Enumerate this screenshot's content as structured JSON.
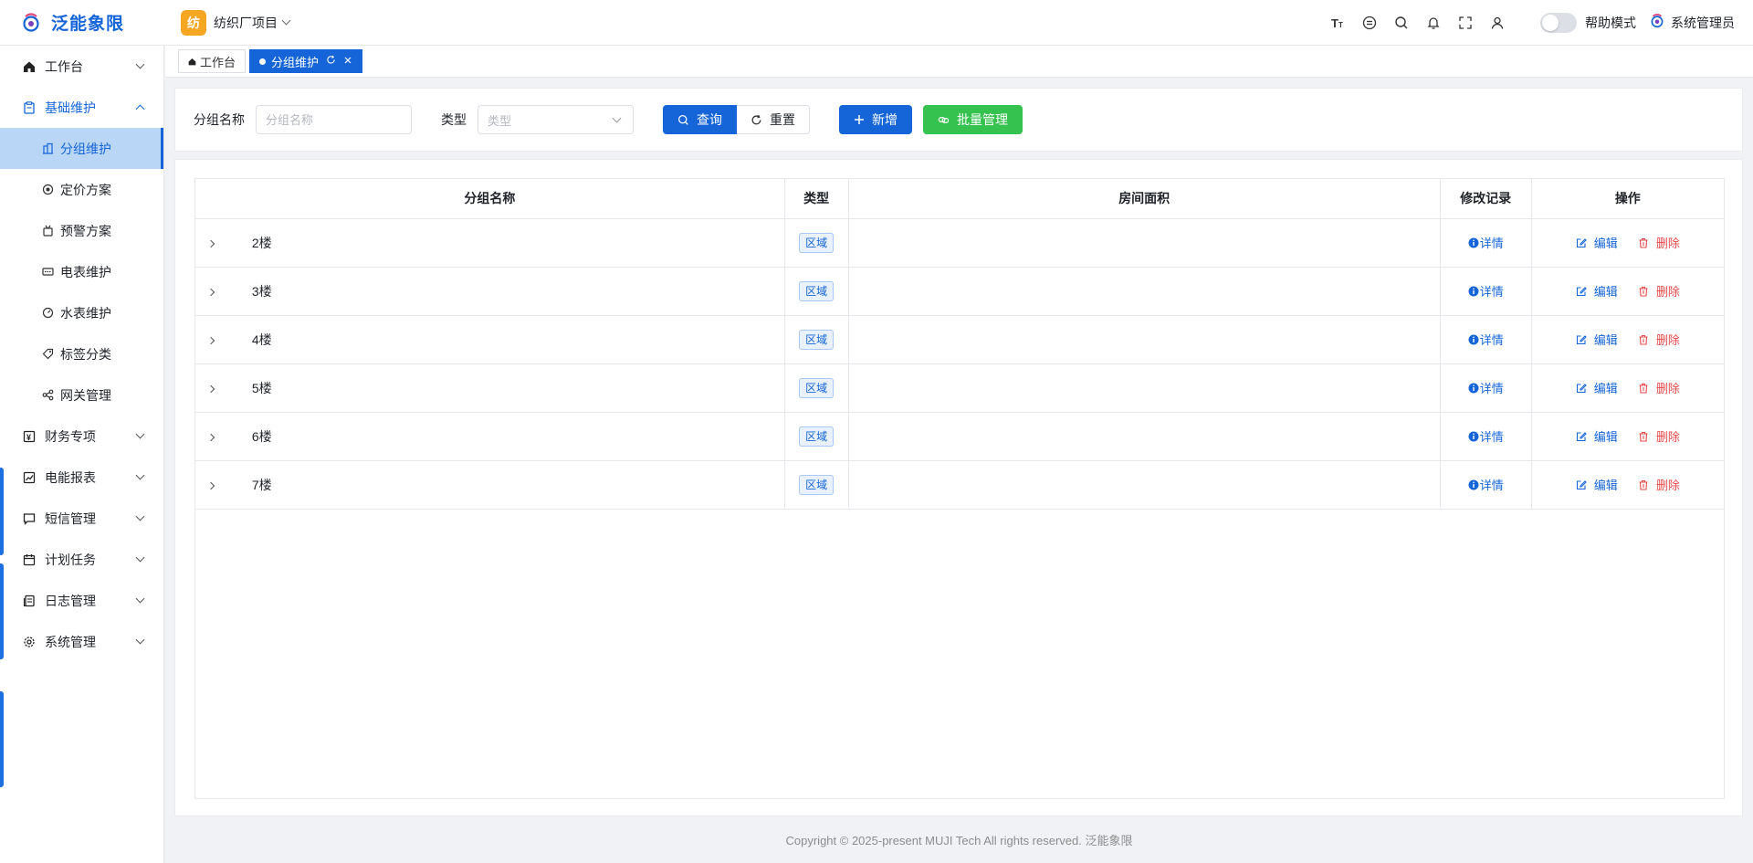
{
  "header": {
    "app_name": "泛能象限",
    "project_badge": "纺",
    "project_name": "纺织厂项目",
    "help_mode_label": "帮助模式",
    "user_name": "系统管理员",
    "icons": [
      "text-size-icon",
      "theme-icon",
      "search-icon",
      "bell-icon",
      "fullscreen-icon",
      "user-icon"
    ]
  },
  "sidebar": {
    "items": [
      {
        "label": "工作台",
        "icon": "home-icon",
        "expanded": false
      },
      {
        "label": "基础维护",
        "icon": "clipboard-icon",
        "expanded": true,
        "children": [
          {
            "label": "分组维护",
            "icon": "building-icon",
            "active": true
          },
          {
            "label": "定价方案",
            "icon": "price-icon"
          },
          {
            "label": "预警方案",
            "icon": "alarm-icon"
          },
          {
            "label": "电表维护",
            "icon": "meter-icon"
          },
          {
            "label": "水表维护",
            "icon": "gauge-icon"
          },
          {
            "label": "标签分类",
            "icon": "tag-icon"
          },
          {
            "label": "网关管理",
            "icon": "share-icon"
          }
        ]
      },
      {
        "label": "财务专项",
        "icon": "finance-icon",
        "expanded": false
      },
      {
        "label": "电能报表",
        "icon": "chart-icon",
        "expanded": false
      },
      {
        "label": "短信管理",
        "icon": "message-icon",
        "expanded": false
      },
      {
        "label": "计划任务",
        "icon": "calendar-icon",
        "expanded": false
      },
      {
        "label": "日志管理",
        "icon": "log-icon",
        "expanded": false
      },
      {
        "label": "系统管理",
        "icon": "settings-icon",
        "expanded": false
      }
    ]
  },
  "tabs": [
    {
      "label": "工作台",
      "active": false
    },
    {
      "label": "分组维护",
      "active": true
    }
  ],
  "search": {
    "group_name_label": "分组名称",
    "group_name_placeholder": "分组名称",
    "type_label": "类型",
    "type_placeholder": "类型",
    "query_label": "查询",
    "reset_label": "重置",
    "add_label": "新增",
    "batch_label": "批量管理"
  },
  "table": {
    "columns": [
      "分组名称",
      "类型",
      "房间面积",
      "修改记录",
      "操作"
    ],
    "rows": [
      {
        "name": "2楼",
        "type": "区域",
        "area": ""
      },
      {
        "name": "3楼",
        "type": "区域",
        "area": ""
      },
      {
        "name": "4楼",
        "type": "区域",
        "area": ""
      },
      {
        "name": "5楼",
        "type": "区域",
        "area": ""
      },
      {
        "name": "6楼",
        "type": "区域",
        "area": ""
      },
      {
        "name": "7楼",
        "type": "区域",
        "area": ""
      }
    ],
    "detail_label": "详情",
    "edit_label": "编辑",
    "delete_label": "删除"
  },
  "footer": {
    "copyright": "Copyright © 2025-present MUJI Tech All rights reserved. 泛能象限"
  },
  "colors": {
    "primary": "#1565d8",
    "success": "#35c24f",
    "danger": "#e84a4a",
    "project_badge": "#f5a623"
  }
}
